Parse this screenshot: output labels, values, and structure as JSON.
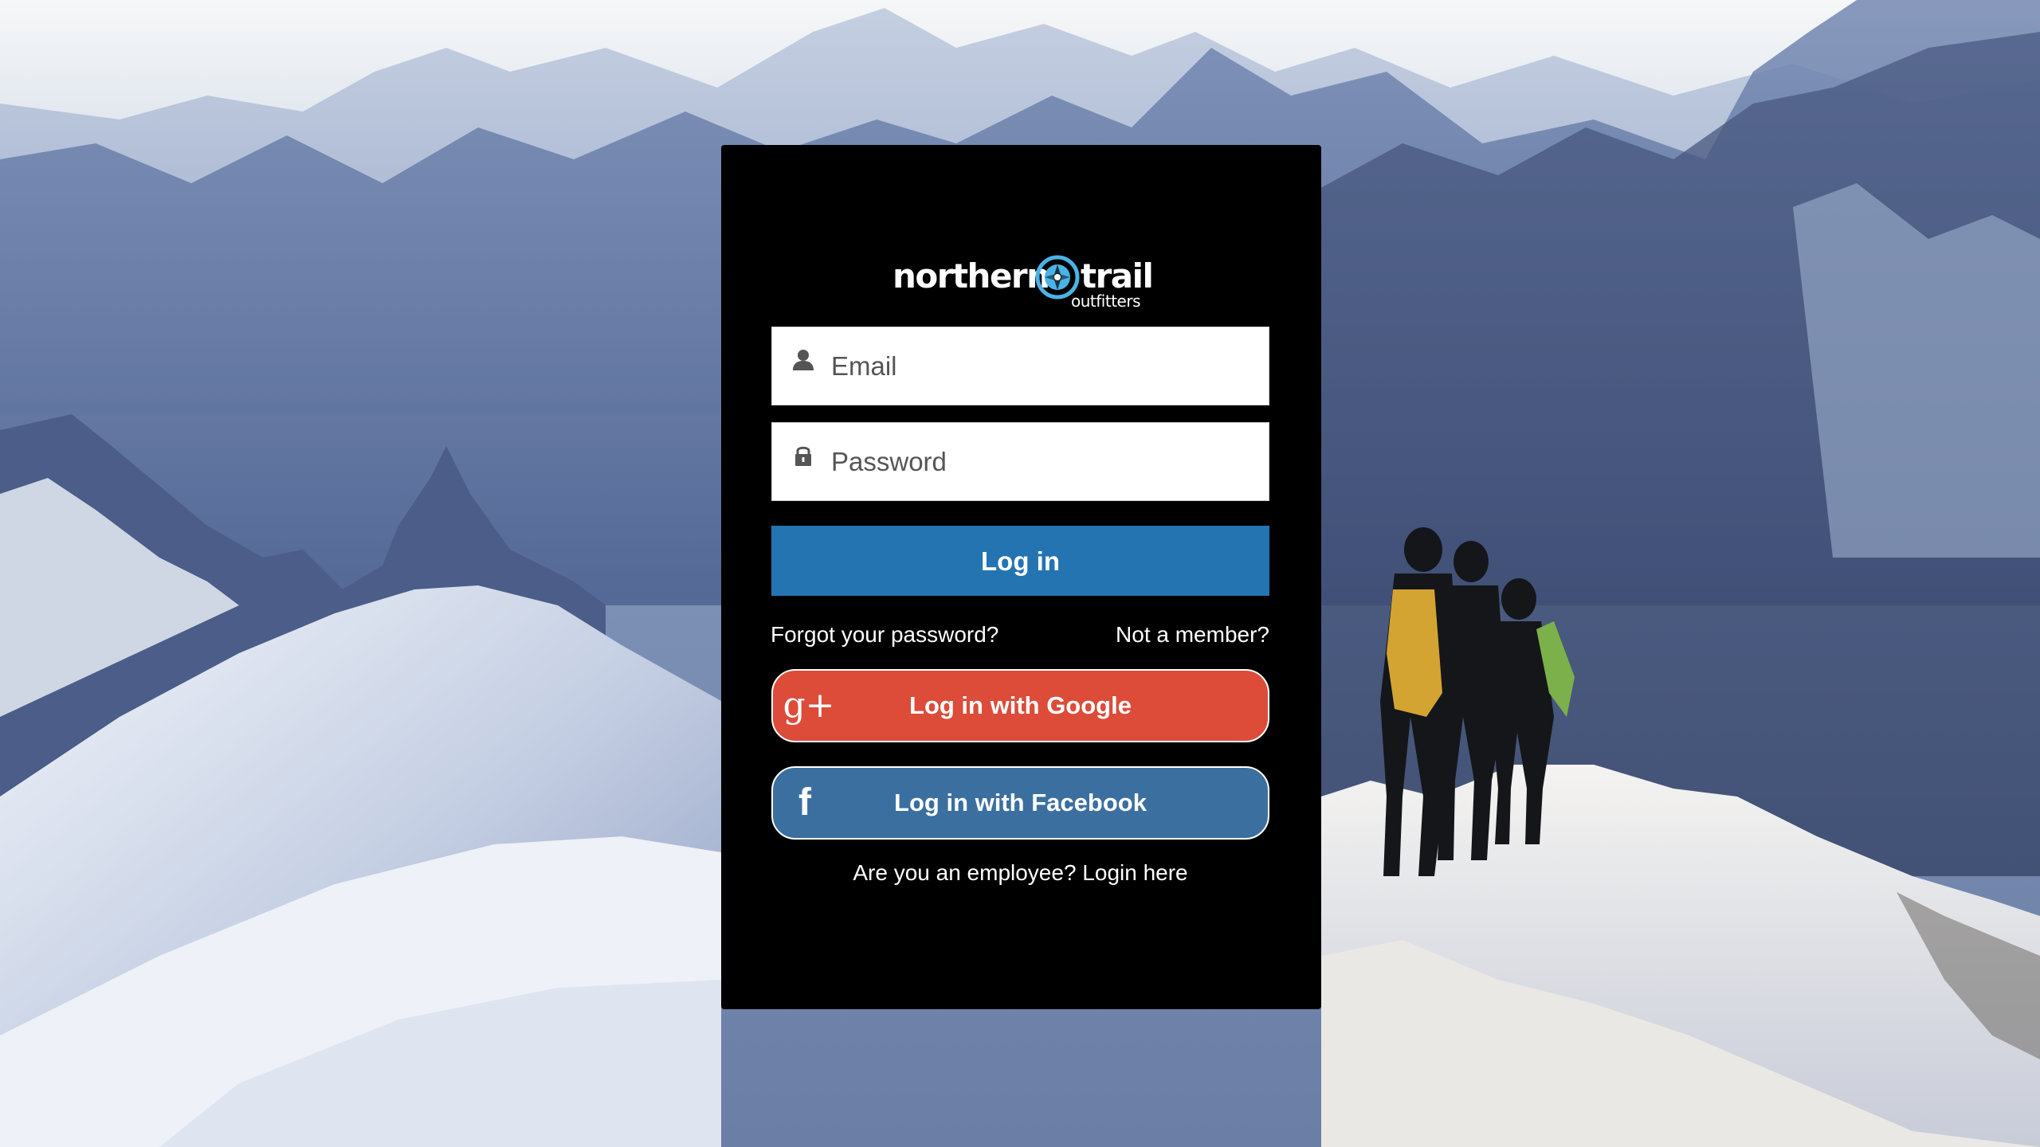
{
  "brand": {
    "name_left": "northern",
    "name_right": "trail",
    "tagline": "outfitters",
    "accent_color": "#4ab3e6"
  },
  "form": {
    "email": {
      "placeholder": "Email",
      "value": "",
      "icon": "user-icon"
    },
    "password": {
      "placeholder": "Password",
      "value": "",
      "icon": "lock-icon"
    },
    "login_button": "Log in",
    "login_button_color": "#2474b1"
  },
  "links": {
    "forgot": "Forgot your password?",
    "member": "Not a member?",
    "employee": "Are you an employee? Login here"
  },
  "social": {
    "google": {
      "label": "Log in with Google",
      "icon_glyph": "g+",
      "icon": "google-plus-icon",
      "color": "#dd4b39"
    },
    "facebook": {
      "label": "Log in with Facebook",
      "icon_glyph": "f",
      "icon": "facebook-icon",
      "color": "#3b6fa0"
    }
  },
  "background": {
    "description_icon": "mountain-background-image"
  }
}
